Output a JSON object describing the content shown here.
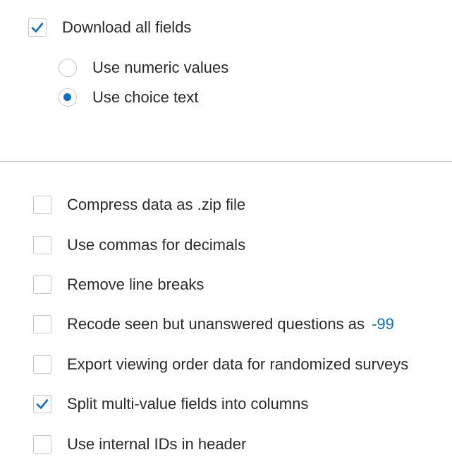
{
  "download_all": {
    "label": "Download all fields",
    "checked": true
  },
  "value_format": {
    "options": [
      {
        "label": "Use numeric values",
        "selected": false
      },
      {
        "label": "Use choice text",
        "selected": true
      }
    ]
  },
  "options": [
    {
      "label": "Compress data as .zip file",
      "checked": false
    },
    {
      "label": "Use commas for decimals",
      "checked": false
    },
    {
      "label": "Remove line breaks",
      "checked": false
    },
    {
      "label": "Recode seen but unanswered questions as",
      "value": "-99",
      "checked": false
    },
    {
      "label": "Export viewing order data for randomized surveys",
      "checked": false
    },
    {
      "label": "Split multi-value fields into columns",
      "checked": true
    },
    {
      "label": "Use internal IDs in header",
      "checked": false
    }
  ],
  "colors": {
    "accent": "#0b6fc6",
    "border": "#c9c9c9",
    "text": "#2a2a2a"
  }
}
